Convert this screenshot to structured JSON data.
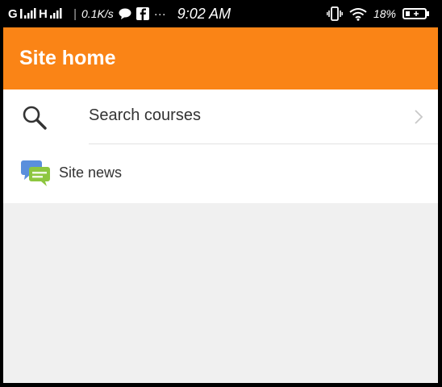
{
  "status_bar": {
    "carrier_1": "G",
    "carrier_2": "H",
    "network_speed": "0.1K/s",
    "notification_icons": [
      "chat-bubble-icon",
      "facebook-icon",
      "more-dots-icon"
    ],
    "more_label": "···",
    "time": "9:02 AM",
    "battery_percent": "18%",
    "right_icons": [
      "vibrate-icon",
      "wifi-icon",
      "battery-icon"
    ]
  },
  "app_bar": {
    "title": "Site home",
    "color": "#fa8416"
  },
  "list": {
    "search": {
      "label": "Search courses",
      "icon": "search-icon",
      "trailing_icon": "chevron-right-icon"
    },
    "news": {
      "label": "Site news",
      "icon": "news-chat-icon"
    }
  }
}
